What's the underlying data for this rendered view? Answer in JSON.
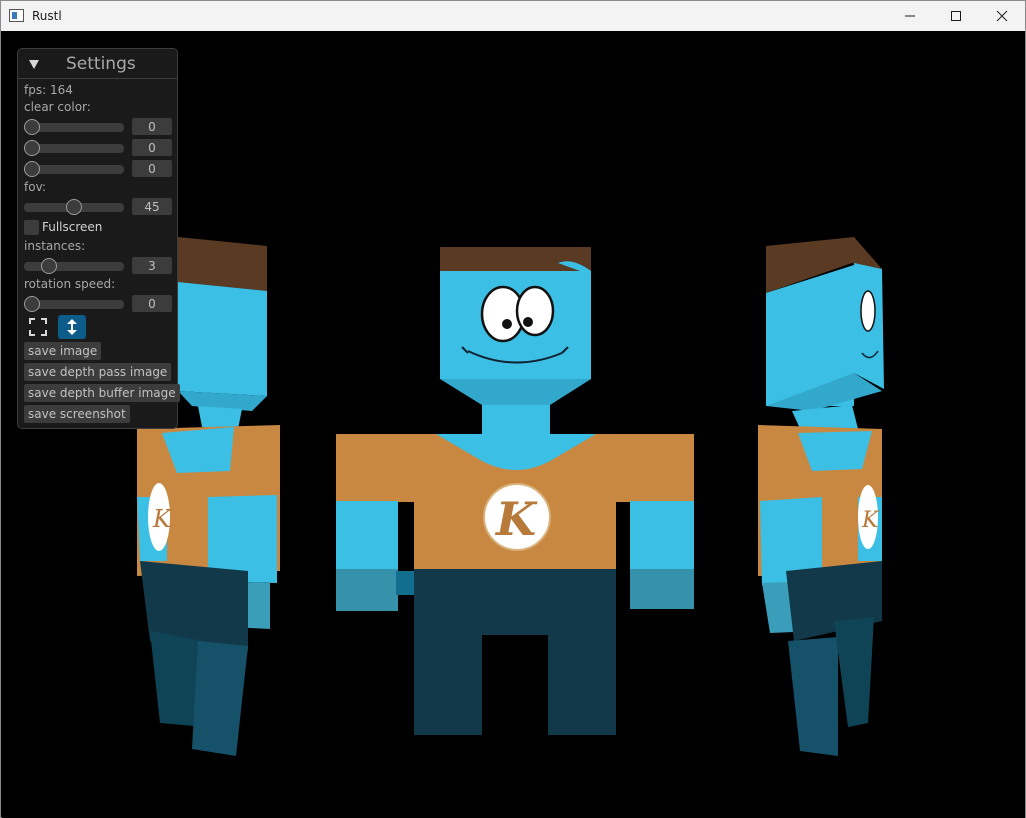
{
  "window": {
    "title": "Rustl",
    "buttons": {
      "minimize": "minimize-icon",
      "maximize": "maximize-icon",
      "close": "close-icon"
    }
  },
  "colors": {
    "panel_bg": "#1b1b1b",
    "widget_bg": "#3c3c3c",
    "accent": "#0d5b8a",
    "skin": "#3bbfe4",
    "shirt": "#c98842",
    "pants": "#12394a",
    "hair": "#5a3a22"
  },
  "settings": {
    "title": "Settings",
    "collapse_icon": "triangle-down-icon",
    "fps_label": "fps: 164",
    "clear_color_label": "clear color:",
    "clear_color": {
      "r": {
        "value": "0",
        "fraction": 0
      },
      "g": {
        "value": "0",
        "fraction": 0
      },
      "b": {
        "value": "0",
        "fraction": 0
      }
    },
    "fov_label": "fov:",
    "fov": {
      "value": "45",
      "fraction": 0.5
    },
    "fullscreen_label": "Fullscreen",
    "fullscreen_checked": false,
    "instances_label": "instances:",
    "instances": {
      "value": "3",
      "fraction": 0.2
    },
    "rotation_speed_label": "rotation speed:",
    "rotation_speed": {
      "value": "0",
      "fraction": 0
    },
    "icons": [
      "fullscreen-corners-icon",
      "vertical-resize-icon"
    ],
    "buttons": {
      "save_image": "save image",
      "save_depth_pass_image": "save depth pass image",
      "save_depth_buffer_image": "save depth buffer image",
      "save_screenshot": "save screenshot"
    }
  },
  "scene": {
    "logo_letter": "K",
    "character_count": 3
  }
}
